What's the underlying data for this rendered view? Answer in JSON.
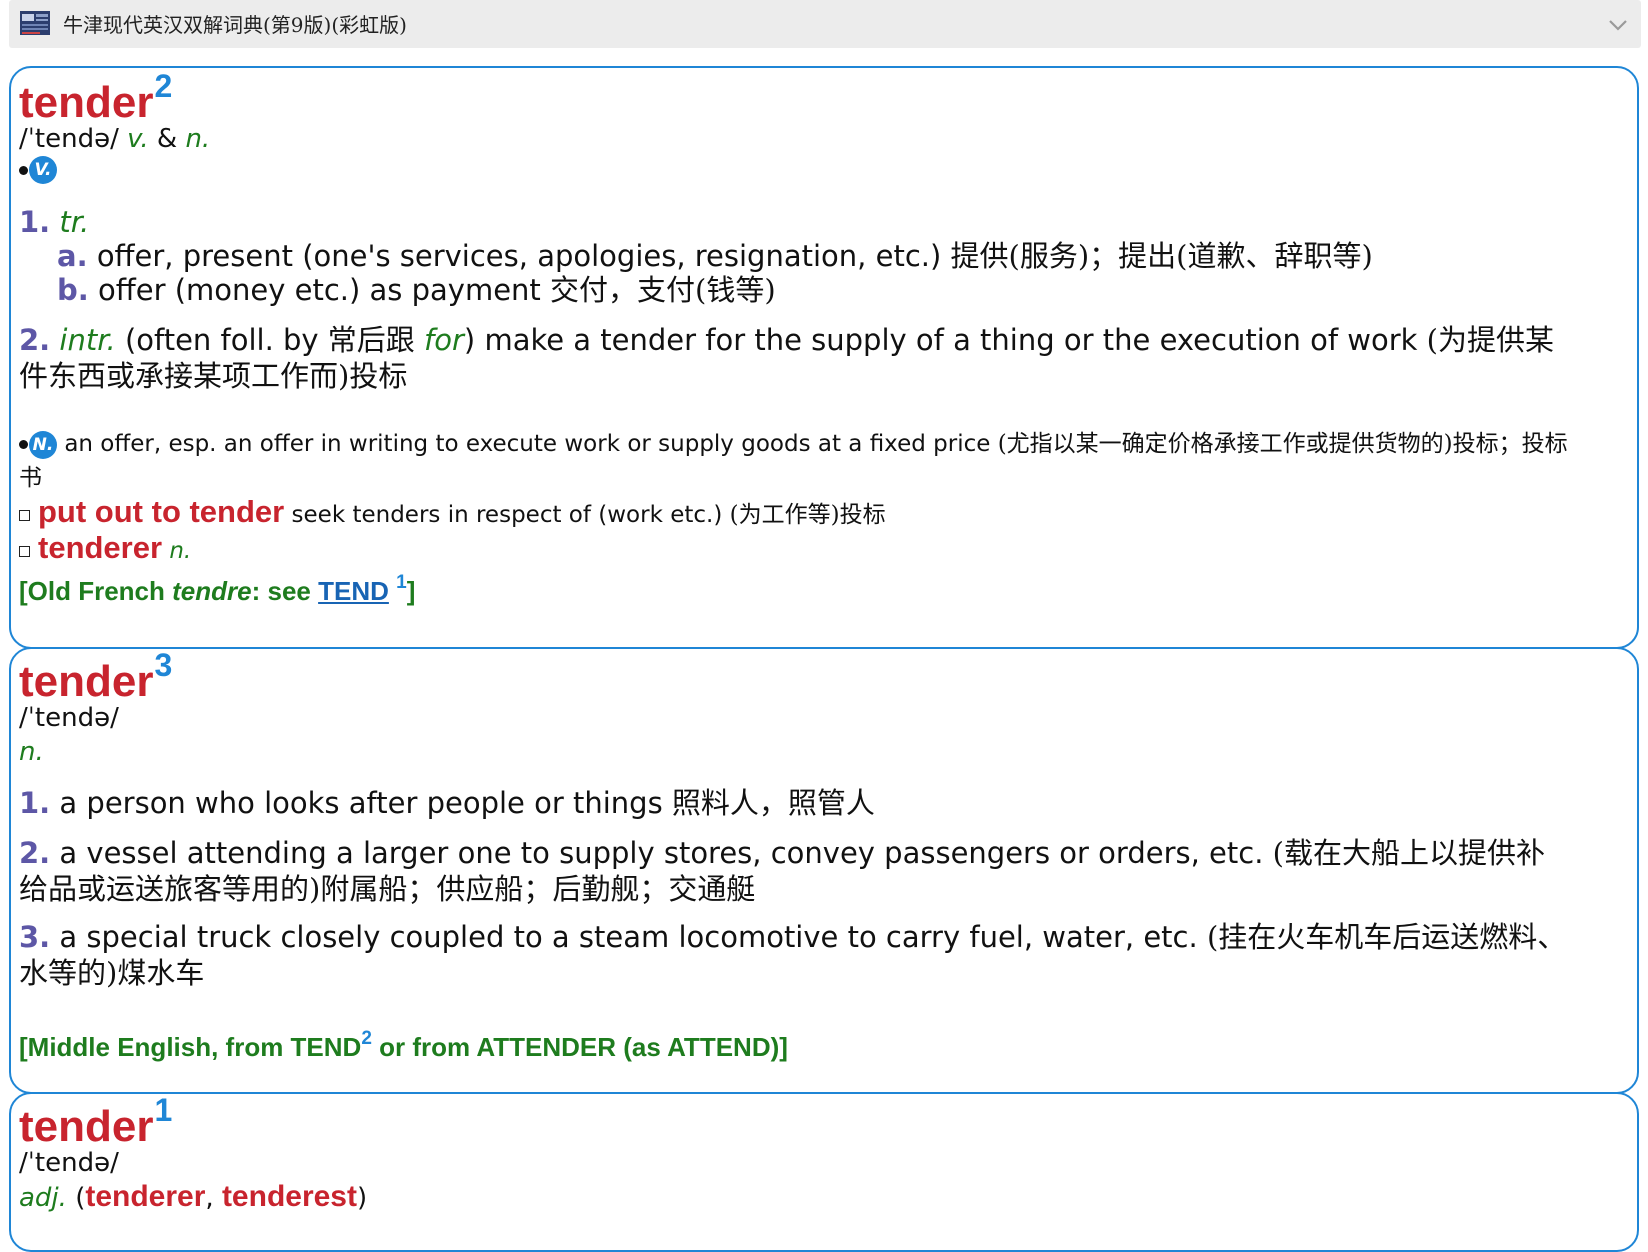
{
  "dictionary": {
    "title": "牛津现代英汉双解词典(第9版)(彩虹版)",
    "icon": "dictionary-book-icon",
    "dropdown_icon": "chevron-down-icon"
  },
  "entry2": {
    "headword": "tender",
    "homograph": "2",
    "pron": "/ˈtendə/",
    "pos_v": "v.",
    "amp": "&",
    "pos_n": "n.",
    "badge_v": "V.",
    "s1_num": "1.",
    "s1_label": "tr.",
    "s1a_letter": "a.",
    "s1a_text": "offer, present (one's services, apologies, resignation, etc.)",
    "s1a_cn": "提供(服务)；提出(道歉、辞职等)",
    "s1b_letter": "b.",
    "s1b_text": "offer (money etc.) as payment",
    "s1b_cn": "交付，支付(钱等)",
    "s2_num": "2.",
    "s2_label": "intr.",
    "s2_pre": "(often foll. by",
    "s2_cnmid": "常后跟",
    "s2_for": "for",
    "s2_text": ") make a tender for the supply of a thing or the execution of work",
    "s2_cn": "(为提供某件东西或承接某项工作而)投标",
    "badge_n": "N.",
    "n_text": "an offer, esp. an offer in writing to execute work or supply goods at a fixed price",
    "n_cn": "(尤指以某一确定价格承接工作或提供货物的)投标；投标书",
    "phrase1": "put out to tender",
    "phrase1_text": "seek tenders in respect of (work etc.)",
    "phrase1_cn": "(为工作等)投标",
    "phrase2": "tenderer",
    "phrase2_pos": "n.",
    "etym_pre": "[Old French",
    "etym_word": "tendre",
    "etym_mid": ": see",
    "etym_link": "TEND",
    "etym_sup": "1",
    "etym_end": "]"
  },
  "entry3": {
    "headword": "tender",
    "homograph": "3",
    "pron": "/ˈtendə/",
    "pos": "n.",
    "s1_num": "1.",
    "s1_text": "a person who looks after people or things",
    "s1_cn": "照料人，照管人",
    "s2_num": "2.",
    "s2_text": "a vessel attending a larger one to supply stores, convey passengers or orders, etc.",
    "s2_cn": "(载在大船上以提供补给品或运送旅客等用的)附属船；供应船；后勤舰；交通艇",
    "s3_num": "3.",
    "s3_text": "a special truck closely coupled to a steam locomotive to carry fuel, water, etc.",
    "s3_cn": "(挂在火车机车后运送燃料、水等的)煤水车",
    "etym_pre": "[Middle English, from TEND",
    "etym_sup": "2",
    "etym_end": " or from ATTENDER (as ATTEND)]"
  },
  "entry1": {
    "headword": "tender",
    "homograph": "1",
    "pron": "/ˈtendə/",
    "pos": "adj.",
    "open": "(",
    "form1": "tenderer",
    "comma": ",",
    "form2": "tenderest",
    "close": ")"
  },
  "colors": {
    "headword": "#c8242e",
    "accent": "#1f86d6",
    "pos": "#1e7c1e",
    "sense_number": "#5d57a6",
    "etymology": "#1e7c1e"
  }
}
